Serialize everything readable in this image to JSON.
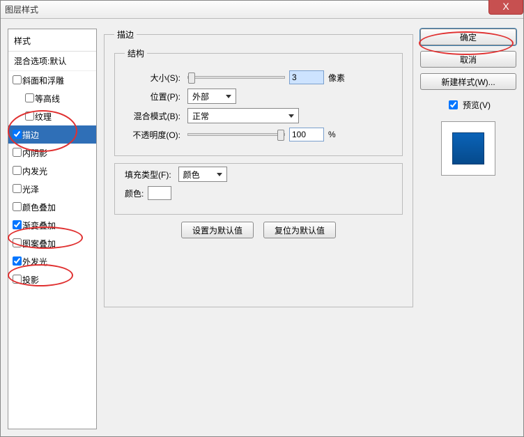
{
  "window": {
    "title": "图层样式"
  },
  "close_x": "X",
  "styles": {
    "header": "样式",
    "blend_options": "混合选项:默认",
    "items": [
      {
        "label": "斜面和浮雕",
        "checked": false,
        "indent": false
      },
      {
        "label": "等高线",
        "checked": false,
        "indent": true
      },
      {
        "label": "纹理",
        "checked": false,
        "indent": true
      },
      {
        "label": "描边",
        "checked": true,
        "indent": false,
        "selected": true
      },
      {
        "label": "内阴影",
        "checked": false,
        "indent": false
      },
      {
        "label": "内发光",
        "checked": false,
        "indent": false
      },
      {
        "label": "光泽",
        "checked": false,
        "indent": false
      },
      {
        "label": "颜色叠加",
        "checked": false,
        "indent": false
      },
      {
        "label": "渐变叠加",
        "checked": true,
        "indent": false
      },
      {
        "label": "图案叠加",
        "checked": false,
        "indent": false
      },
      {
        "label": "外发光",
        "checked": true,
        "indent": false
      },
      {
        "label": "投影",
        "checked": false,
        "indent": false
      }
    ]
  },
  "stroke": {
    "legend": "描边",
    "structure_legend": "结构",
    "size_label": "大小(S):",
    "size_value": "3",
    "size_unit": "像素",
    "position_label": "位置(P):",
    "position_value": "外部",
    "blend_label": "混合模式(B):",
    "blend_value": "正常",
    "opacity_label": "不透明度(O):",
    "opacity_value": "100",
    "opacity_unit": "%",
    "filltype_label": "填充类型(F):",
    "filltype_value": "颜色",
    "color_label": "颜色:",
    "set_default": "设置为默认值",
    "reset_default": "复位为默认值"
  },
  "buttons": {
    "ok": "确定",
    "cancel": "取消",
    "new_style": "新建样式(W)...",
    "preview": "预览(V)"
  }
}
